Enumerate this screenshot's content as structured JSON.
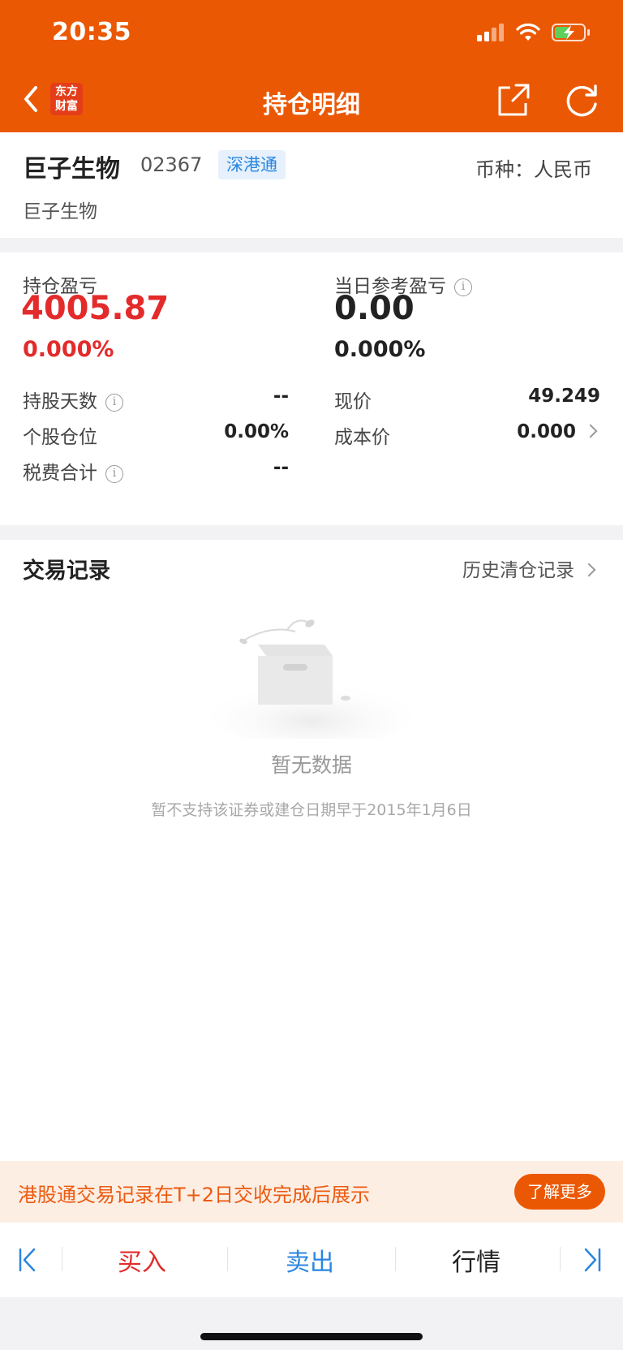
{
  "status_bar": {
    "time": "20:35"
  },
  "nav": {
    "title": "持仓明细",
    "logo_text_line1": "东方",
    "logo_text_line2": "财富"
  },
  "stock": {
    "name": "巨子生物",
    "code": "02367",
    "market": "深港通",
    "currency_label": "币种：人民币",
    "subtitle": "巨子生物"
  },
  "summary": {
    "holding_pl_label": "持仓盈亏",
    "holding_pl_value": "4005.87",
    "holding_pl_pct": "0.000%",
    "daily_pl_label": "当日参考盈亏",
    "daily_pl_value": "0.00",
    "daily_pl_pct": "0.000%",
    "rows": [
      {
        "label": "持股天数",
        "value": "--"
      },
      {
        "label": "个股仓位",
        "value": "0.00%"
      },
      {
        "label": "税费合计",
        "value": "--"
      }
    ],
    "right_rows": [
      {
        "label": "现价",
        "value": "49.249"
      },
      {
        "label": "成本价",
        "value": "0.000"
      }
    ]
  },
  "records": {
    "title": "交易记录",
    "history_link": "历史清仓记录",
    "empty_title": "暂无数据",
    "empty_sub": "暂不支持该证券或建仓日期早于2015年1月6日"
  },
  "notice": {
    "text": "港股通交易记录在T+2日交收完成后展示",
    "button": "了解更多"
  },
  "tabs": {
    "buy": "买入",
    "sell": "卖出",
    "quote": "行情"
  },
  "colors": {
    "brand": "#eb5803",
    "up": "#e32b2b",
    "link_blue": "#2a86e0"
  }
}
